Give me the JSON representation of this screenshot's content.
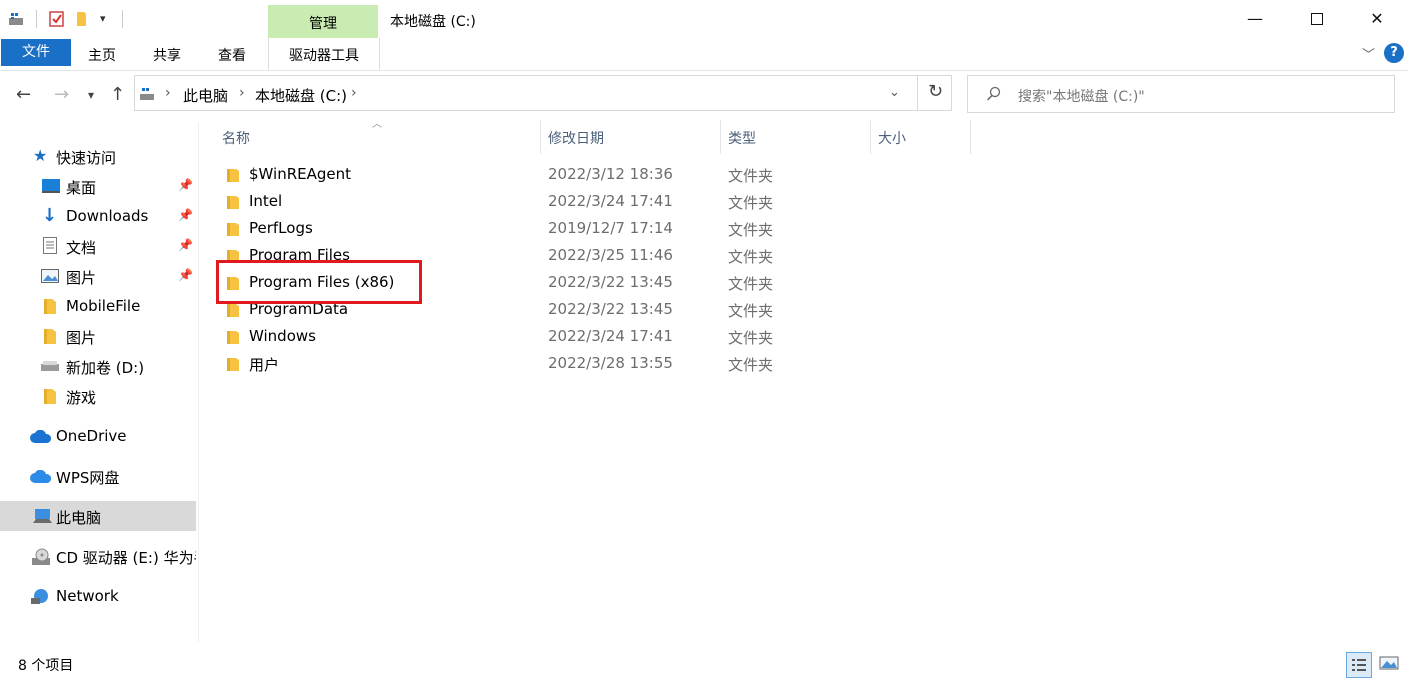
{
  "window": {
    "title": "本地磁盘 (C:)"
  },
  "ribbon": {
    "contextual_group": "管理",
    "tabs": [
      "文件",
      "主页",
      "共享",
      "查看",
      "驱动器工具"
    ]
  },
  "address": {
    "crumbs": [
      "此电脑",
      "本地磁盘 (C:)"
    ]
  },
  "search": {
    "placeholder": "搜索\"本地磁盘 (C:)\""
  },
  "sidebar": {
    "items": [
      {
        "label": "快速访问",
        "icon": "star-icon"
      },
      {
        "label": "桌面",
        "icon": "desktop-icon",
        "pinned": true
      },
      {
        "label": "Downloads",
        "icon": "download-arrow-icon",
        "pinned": true
      },
      {
        "label": "文档",
        "icon": "document-icon",
        "pinned": true
      },
      {
        "label": "图片",
        "icon": "pictures-icon",
        "pinned": true
      },
      {
        "label": "MobileFile",
        "icon": "folder-icon"
      },
      {
        "label": "图片",
        "icon": "folder-icon"
      },
      {
        "label": "新加卷 (D:)",
        "icon": "drive-icon"
      },
      {
        "label": "游戏",
        "icon": "folder-icon"
      },
      {
        "label": "OneDrive",
        "icon": "cloud-icon"
      },
      {
        "label": "WPS网盘",
        "icon": "cloud-icon"
      },
      {
        "label": "此电脑",
        "icon": "computer-icon",
        "selected": true
      },
      {
        "label": "CD 驱动器 (E:) 华为手",
        "icon": "cd-drive-icon"
      },
      {
        "label": "Network",
        "icon": "network-icon"
      }
    ]
  },
  "columns": {
    "name": "名称",
    "date": "修改日期",
    "type": "类型",
    "size": "大小"
  },
  "files": [
    {
      "name": "$WinREAgent",
      "date": "2022/3/12 18:36",
      "type": "文件夹"
    },
    {
      "name": "Intel",
      "date": "2022/3/24 17:41",
      "type": "文件夹"
    },
    {
      "name": "PerfLogs",
      "date": "2019/12/7 17:14",
      "type": "文件夹"
    },
    {
      "name": "Program Files",
      "date": "2022/3/25 11:46",
      "type": "文件夹"
    },
    {
      "name": "Program Files (x86)",
      "date": "2022/3/22 13:45",
      "type": "文件夹"
    },
    {
      "name": "ProgramData",
      "date": "2022/3/22 13:45",
      "type": "文件夹"
    },
    {
      "name": "Windows",
      "date": "2022/3/24 17:41",
      "type": "文件夹"
    },
    {
      "name": "用户",
      "date": "2022/3/28 13:55",
      "type": "文件夹"
    }
  ],
  "status": {
    "item_count": "8 个项目"
  },
  "colors": {
    "accent": "#1a6fc6",
    "manage_tab": "#c9ecb2",
    "highlight": "#e0191e",
    "folder": "#f5c242"
  }
}
